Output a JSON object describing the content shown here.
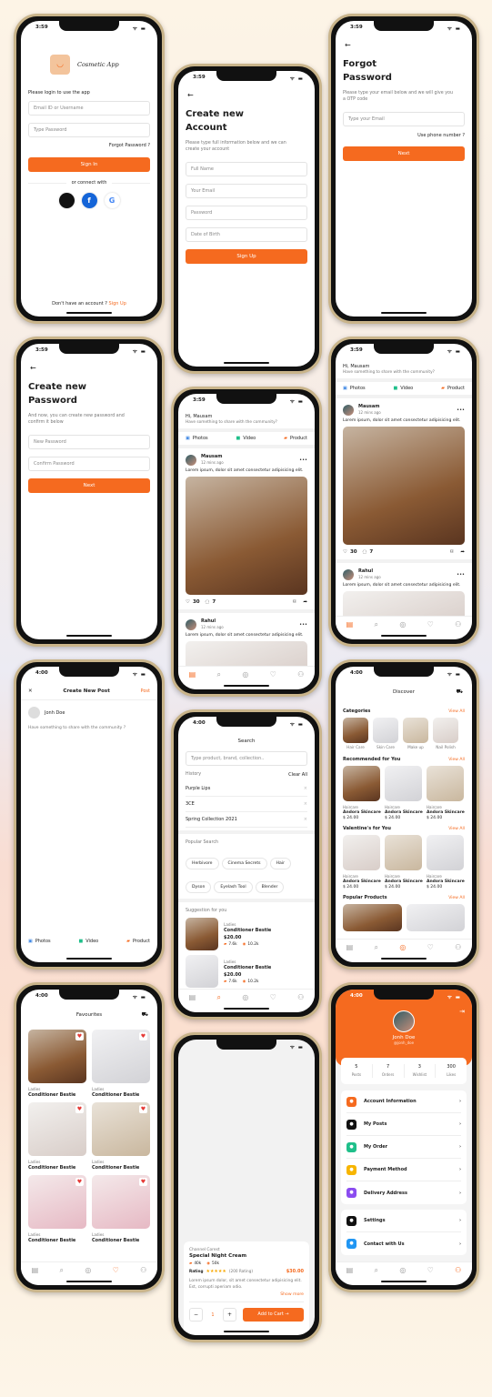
{
  "colors": {
    "accent": "#f56a1f",
    "frame": "#c9b48a"
  },
  "nav_icons": [
    "post-icon",
    "search-icon",
    "compass-icon",
    "heart-icon",
    "user-icon"
  ],
  "login": {
    "time": "3:59",
    "app_name": "Cosmetic App",
    "prompt": "Please login to use the app",
    "email_placeholder": "Email ID or Username",
    "password_placeholder": "Type Password",
    "forgot": "Forgot Password ?",
    "sign_in": "Sign In",
    "or_connect": "or connect with",
    "social": [
      "apple-icon",
      "facebook-icon",
      "google-icon"
    ],
    "no_account": "Don't have an account ?",
    "sign_up": "Sign Up"
  },
  "create_account": {
    "time": "3:59",
    "title": "Create new Account",
    "desc": "Please type full information below and we can create your account",
    "fields": [
      "Full Name",
      "Your Email",
      "Password",
      "Date of Birth"
    ],
    "button": "Sign Up"
  },
  "forgot": {
    "time": "3:59",
    "title": "Forgot Password",
    "desc": "Please type your email below and we will give you a OTP code",
    "email_placeholder": "Type your Email",
    "alt": "Use phone number ?",
    "button": "Next"
  },
  "new_password": {
    "time": "3:59",
    "title": "Create new Password",
    "desc": "And now, you can create new password and confirm it below",
    "fields": [
      "New Password",
      "Confirm Password"
    ],
    "button": "Next"
  },
  "feed": {
    "time": "3:59",
    "greeting": "Hi, Mausam",
    "sub": "Have something to share with the community?",
    "tabs": [
      "Photos",
      "Video",
      "Product"
    ],
    "posts": [
      {
        "user": "Mausam",
        "time": "12 mins ago",
        "text": "Lorem ipsum, dolor sit amet consectetur adipisicing elit.",
        "likes": "30",
        "comments": "7"
      },
      {
        "user": "Rahul",
        "time": "12 mins ago",
        "text": "Lorem ipsum, dolor sit amet consectetur adipisicing elit."
      }
    ]
  },
  "create_post": {
    "time": "4:00",
    "close": "✕",
    "title": "Create New Post",
    "post": "Post",
    "user": "Jonh Doe",
    "placeholder": "Have something to share with the community ?",
    "tabs": [
      "Photos",
      "Video",
      "Product"
    ]
  },
  "search": {
    "time": "4:00",
    "title": "Search",
    "placeholder": "Type product, brand, collection..",
    "history_label": "History",
    "clear_all": "Clear All",
    "history": [
      "Purple Lips",
      "3CE",
      "Spring Collection 2021"
    ],
    "popular_label": "Popular Search",
    "popular": [
      "Herbivore",
      "Cinema Secrets",
      "Hair",
      "Dyson",
      "Eyelash Tool",
      "Blender"
    ],
    "suggest_label": "Suggestion for you",
    "suggestions": [
      {
        "cat": "Ladies",
        "name": "Conditioner Bestie",
        "price": "$20.00",
        "sold": "7.6k",
        "views": "10.2k"
      },
      {
        "cat": "Ladies",
        "name": "Conditioner Bestie",
        "price": "$20.00",
        "sold": "7.6k",
        "views": "10.2k"
      }
    ]
  },
  "discover": {
    "time": "4:00",
    "title": "Discover",
    "view_all": "View All",
    "categories_label": "Categories",
    "categories": [
      "Hair Care",
      "Skin Care",
      "Make up",
      "Nail Polish"
    ],
    "sections": [
      {
        "title": "Recommended for You",
        "items": [
          {
            "cat": "Haircare",
            "name": "Andora Skincare",
            "price": "$ 24.00"
          },
          {
            "cat": "Haircare",
            "name": "Andora Skincare",
            "price": "$ 24.00"
          },
          {
            "cat": "Haircare",
            "name": "Andora Skincare",
            "price": "$ 24.00"
          }
        ]
      },
      {
        "title": "Valentine's for You",
        "items": [
          {
            "cat": "Haircare",
            "name": "Andora Skincare",
            "price": "$ 24.00"
          },
          {
            "cat": "Haircare",
            "name": "Andora Skincare",
            "price": "$ 24.00"
          },
          {
            "cat": "Haircare",
            "name": "Andora Skincare",
            "price": "$ 24.00"
          }
        ]
      }
    ],
    "popular_label": "Popular Products"
  },
  "favourites": {
    "time": "4:00",
    "title": "Favourites",
    "items": [
      {
        "cat": "Ladies",
        "name": "Conditioner Bestie"
      },
      {
        "cat": "Ladies",
        "name": "Conditioner Bestie"
      },
      {
        "cat": "Ladies",
        "name": "Conditioner Bestie"
      },
      {
        "cat": "Ladies",
        "name": "Conditioner Bestie"
      },
      {
        "cat": "Ladies",
        "name": "Conditioner Bestie"
      },
      {
        "cat": "Ladies",
        "name": "Conditioner Bestie"
      }
    ]
  },
  "product": {
    "brand": "Channel Corest",
    "name": "Special Night Cream",
    "sold": "40k",
    "views": "50k",
    "rating_label": "Rating",
    "stars": 5,
    "rating_count": "(200 Rating)",
    "price": "$30.00",
    "desc": "Lorem ipsum dolor, sit amet consectetur adipisicing elit. Est, corrupti aperiam odio.",
    "show_more": "Show more",
    "qty": "1",
    "minus": "−",
    "plus": "+",
    "add_to_cart": "Add to Cart →"
  },
  "profile": {
    "time": "4:00",
    "name": "Jonh Doe",
    "handle": "@jonh_doe",
    "stats": [
      {
        "value": "5",
        "label": "Posts"
      },
      {
        "value": "7",
        "label": "Orders"
      },
      {
        "value": "3",
        "label": "Wishlist"
      },
      {
        "value": "300",
        "label": "Likes"
      }
    ],
    "menu1": [
      {
        "label": "Account Information",
        "color": "#f56a1f",
        "icon": "user-icon"
      },
      {
        "label": "My Posts",
        "color": "#111111",
        "icon": "document-icon"
      },
      {
        "label": "My Order",
        "color": "#1fbf8a",
        "icon": "cart-icon"
      },
      {
        "label": "Payment Method",
        "color": "#f7b500",
        "icon": "wallet-icon"
      },
      {
        "label": "Delivery Address",
        "color": "#8b4cf0",
        "icon": "location-icon"
      }
    ],
    "menu2": [
      {
        "label": "Settings",
        "color": "#111111",
        "icon": "gear-icon"
      },
      {
        "label": "Contact with Us",
        "color": "#2196f3",
        "icon": "chat-icon"
      }
    ]
  }
}
